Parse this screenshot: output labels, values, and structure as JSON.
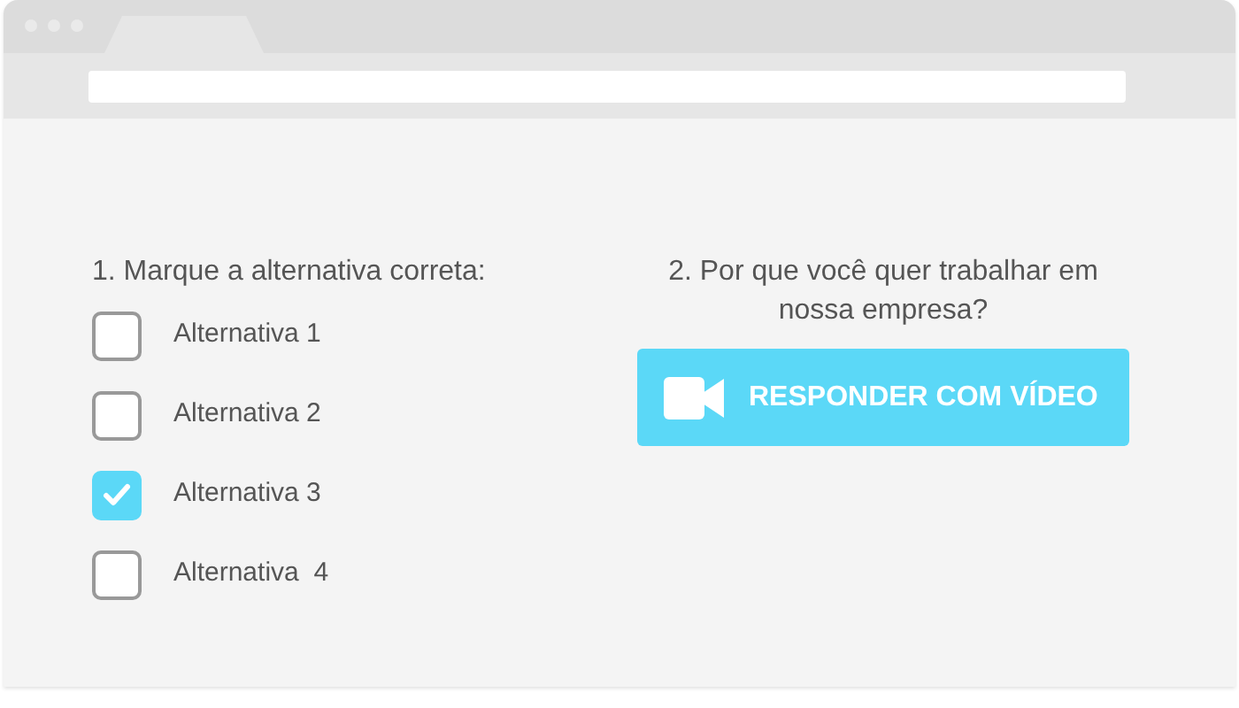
{
  "questions": [
    {
      "kind": "choice",
      "title": "1. Marque a alternativa correta:",
      "options": [
        {
          "label": "Alternativa 1",
          "checked": false
        },
        {
          "label": "Alternativa 2",
          "checked": false
        },
        {
          "label": "Alternativa 3",
          "checked": true
        },
        {
          "label": "Alternativa  4",
          "checked": false
        }
      ]
    },
    {
      "kind": "video",
      "title": "2. Por que você quer trabalhar em nossa empresa?",
      "button": "RESPONDER COM VÍDEO"
    }
  ]
}
